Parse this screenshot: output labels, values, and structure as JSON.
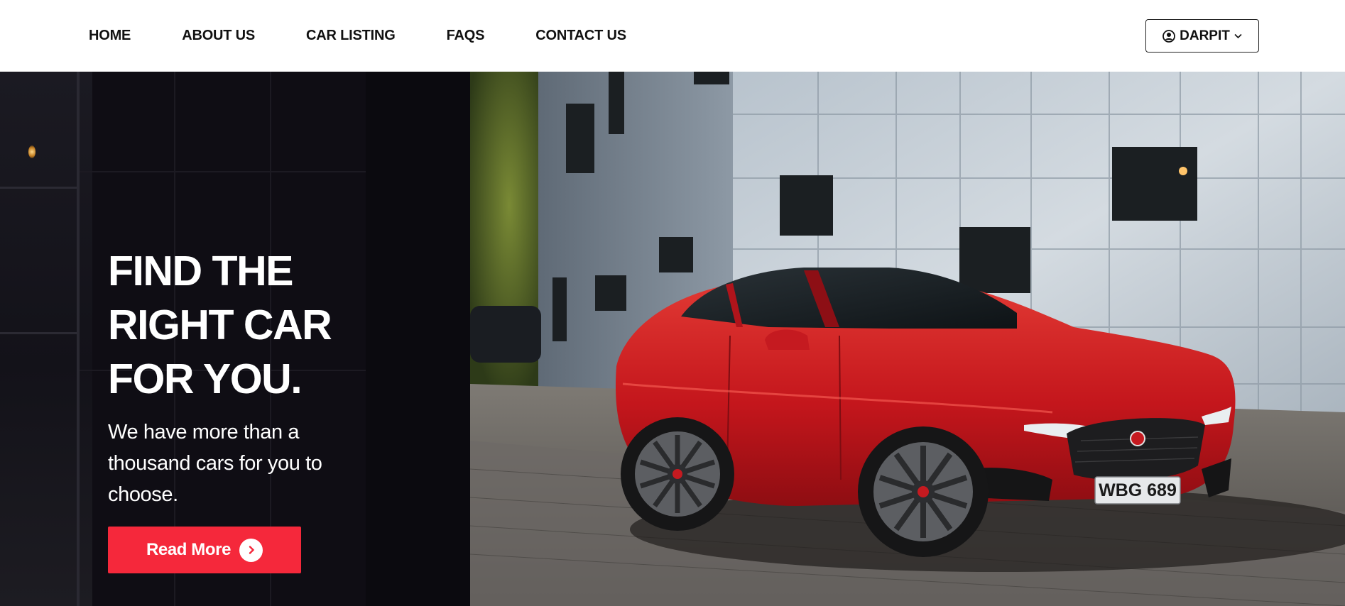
{
  "nav": {
    "links": [
      "HOME",
      "ABOUT US",
      "CAR LISTING",
      "FAQS",
      "CONTACT US"
    ],
    "user": {
      "name": "DARPIT",
      "icon": "user-circle-icon",
      "dropdown_icon": "chevron-down-icon"
    }
  },
  "hero": {
    "title_lines": [
      "FIND THE",
      "RIGHT CAR",
      "FOR YOU."
    ],
    "subtitle_lines": [
      "We have more than a",
      "thousand cars for you to",
      "choose."
    ],
    "cta": {
      "label": "Read More",
      "icon": "arrow-right-circle-icon"
    },
    "car": {
      "plate": "WBG 689",
      "color": "#d41e22"
    }
  },
  "colors": {
    "accent": "#f5283b",
    "header_bg": "#ffffff",
    "hero_left_bg": "#0f0d14",
    "text_dark": "#111111",
    "text_light": "#ffffff"
  }
}
